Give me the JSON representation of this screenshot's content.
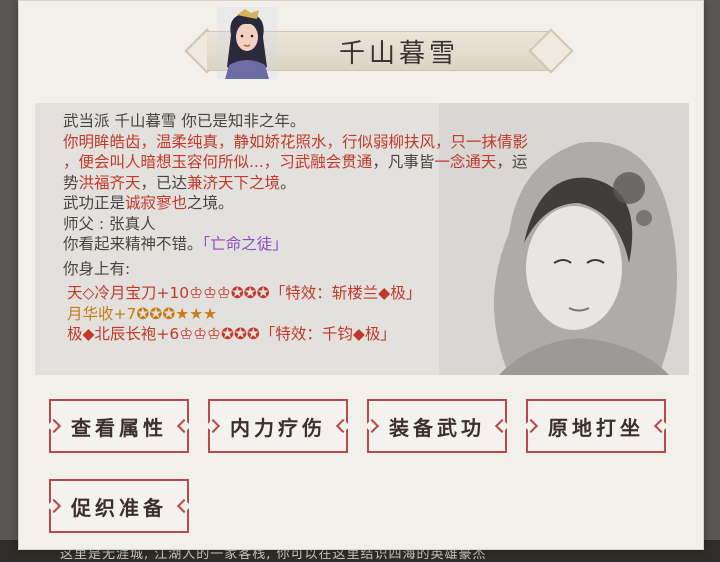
{
  "background": {
    "bottom_text": "这里是无涯城, 江湖人的一家客栈, 你可以在这里结识四海的英雄豪杰"
  },
  "dialog": {
    "title": "千山暮雪",
    "portrait_icon": "female-character-portrait",
    "description": {
      "line1": "武当派  千山暮雪  你已是知非之年。",
      "line2a": "你明眸皓齿，温柔纯真，静如娇花照水，行似弱柳扶风，",
      "line2b": "只一抹倩影",
      "line3a": "，便会叫人暗想玉容何所似...，习武",
      "line3b": "融会贯通",
      "line3c": "，凡事皆",
      "line3d": "一念通天",
      "line3e": "，运",
      "line4a": "势",
      "line4b": "洪福齐天",
      "line4c": "，已达",
      "line4d": "兼济天下之境",
      "line4e": "。",
      "line5a": "武功正是",
      "line5b": "诚寂寥也",
      "line5c": "之境。",
      "line6": "师父 : 张真人",
      "line7a": "你看起来精神不错。",
      "line7b": "「亡命之徒」",
      "line8": "你身上有:",
      "item1": "天◇冷月宝刀+10♔♔♔✪✪✪「特效：斩楼兰◆极」",
      "item2": "月华收+7✪✪✪★★★",
      "item3": "极◆北辰长袍+6♔♔♔✪✪✪「特效：千钧◆极」"
    },
    "buttons": {
      "view_attributes": "查看属性",
      "inner_heal": "内力疗伤",
      "equip_skill": "装备武功",
      "meditate": "原地打坐",
      "prepare_weaving": "促织准备"
    }
  },
  "colors": {
    "highlight_red": "#c0392b",
    "highlight_orange": "#c77c19",
    "highlight_purple": "#8d4cc3",
    "button_border": "#b54a4a"
  }
}
